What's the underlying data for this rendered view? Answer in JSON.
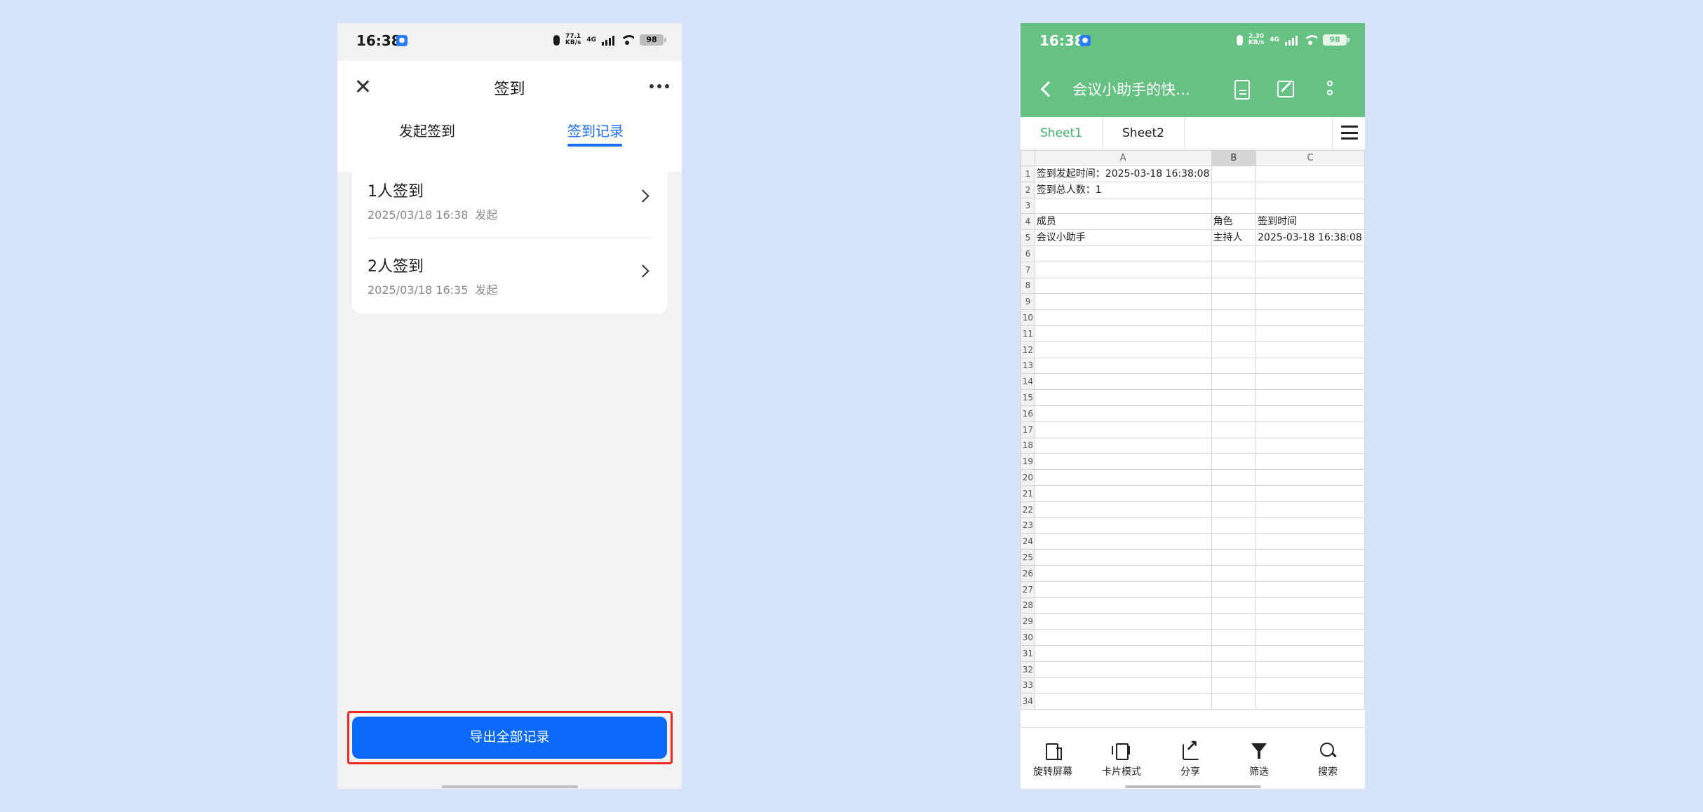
{
  "left": {
    "status": {
      "time": "16:38",
      "speed_top": "77.1",
      "speed_bottom": "KB/s",
      "network": "4G",
      "battery": "98"
    },
    "header": {
      "title": "签到"
    },
    "tabs": [
      {
        "label": "发起签到"
      },
      {
        "label": "签到记录"
      }
    ],
    "records": [
      {
        "title": "1人签到",
        "date": "2025/03/18 16:38",
        "action": "发起"
      },
      {
        "title": "2人签到",
        "date": "2025/03/18 16:35",
        "action": "发起"
      }
    ],
    "export_button": "导出全部记录"
  },
  "right": {
    "status": {
      "time": "16:38",
      "speed_top": "2.30",
      "speed_bottom": "KB/s",
      "network": "4G",
      "battery": "98"
    },
    "doc_title": "会议小助手的快…",
    "sheet_tabs": [
      "Sheet1",
      "Sheet2"
    ],
    "columns": [
      "A",
      "B",
      "C"
    ],
    "selected_column": "B",
    "rows": [
      {
        "n": "1",
        "a": "签到发起时间：2025-03-18 16:38:08",
        "b": "",
        "c": ""
      },
      {
        "n": "2",
        "a": "签到总人数：1",
        "b": "",
        "c": ""
      },
      {
        "n": "3",
        "a": "",
        "b": "",
        "c": ""
      },
      {
        "n": "4",
        "a": "成员",
        "b": "角色",
        "c": "签到时间"
      },
      {
        "n": "5",
        "a": "会议小助手",
        "b": "主持人",
        "c": "2025-03-18 16:38:08"
      },
      {
        "n": "6",
        "a": "",
        "b": "",
        "c": ""
      },
      {
        "n": "7",
        "a": "",
        "b": "",
        "c": ""
      },
      {
        "n": "8",
        "a": "",
        "b": "",
        "c": ""
      },
      {
        "n": "9",
        "a": "",
        "b": "",
        "c": ""
      },
      {
        "n": "10",
        "a": "",
        "b": "",
        "c": ""
      },
      {
        "n": "11",
        "a": "",
        "b": "",
        "c": ""
      },
      {
        "n": "12",
        "a": "",
        "b": "",
        "c": ""
      },
      {
        "n": "13",
        "a": "",
        "b": "",
        "c": ""
      },
      {
        "n": "14",
        "a": "",
        "b": "",
        "c": ""
      },
      {
        "n": "15",
        "a": "",
        "b": "",
        "c": ""
      },
      {
        "n": "16",
        "a": "",
        "b": "",
        "c": ""
      },
      {
        "n": "17",
        "a": "",
        "b": "",
        "c": ""
      },
      {
        "n": "18",
        "a": "",
        "b": "",
        "c": ""
      },
      {
        "n": "19",
        "a": "",
        "b": "",
        "c": ""
      },
      {
        "n": "20",
        "a": "",
        "b": "",
        "c": ""
      },
      {
        "n": "21",
        "a": "",
        "b": "",
        "c": ""
      },
      {
        "n": "22",
        "a": "",
        "b": "",
        "c": ""
      },
      {
        "n": "23",
        "a": "",
        "b": "",
        "c": ""
      },
      {
        "n": "24",
        "a": "",
        "b": "",
        "c": ""
      },
      {
        "n": "25",
        "a": "",
        "b": "",
        "c": ""
      },
      {
        "n": "26",
        "a": "",
        "b": "",
        "c": ""
      },
      {
        "n": "27",
        "a": "",
        "b": "",
        "c": ""
      },
      {
        "n": "28",
        "a": "",
        "b": "",
        "c": ""
      },
      {
        "n": "29",
        "a": "",
        "b": "",
        "c": ""
      },
      {
        "n": "30",
        "a": "",
        "b": "",
        "c": ""
      },
      {
        "n": "31",
        "a": "",
        "b": "",
        "c": ""
      },
      {
        "n": "32",
        "a": "",
        "b": "",
        "c": ""
      },
      {
        "n": "33",
        "a": "",
        "b": "",
        "c": ""
      },
      {
        "n": "34",
        "a": "",
        "b": "",
        "c": ""
      }
    ],
    "toolbar": [
      {
        "label": "旋转屏幕",
        "icon": "rotate-icon"
      },
      {
        "label": "卡片模式",
        "icon": "card-icon"
      },
      {
        "label": "分享",
        "icon": "share-icon"
      },
      {
        "label": "筛选",
        "icon": "filter-icon"
      },
      {
        "label": "搜索",
        "icon": "search-icon"
      }
    ],
    "colors": {
      "header_green": "#65c283",
      "active_tab_green": "#3db466",
      "primary_blue": "#0a6af7",
      "highlight_red": "#f0281e"
    }
  }
}
